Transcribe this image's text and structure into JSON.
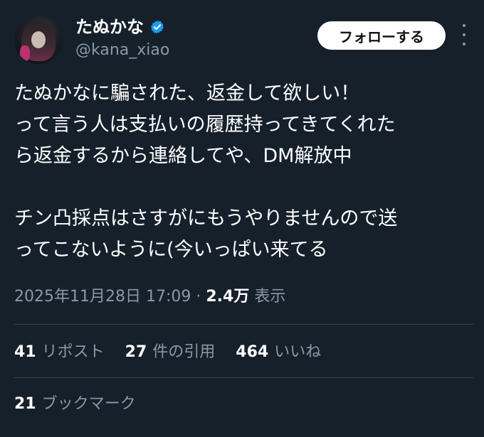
{
  "author": {
    "display_name": "たぬかな",
    "handle": "@kana_xiao",
    "verified_badge_color": "#1d9bf0",
    "avatar_icon": "profile-avatar"
  },
  "actions": {
    "follow_label": "フォローする",
    "more_icon": "more-vertical-icon"
  },
  "tweet": {
    "lines": [
      "たぬかなに騙された、返金して欲しい！",
      "って言う人は支払いの履歴持ってきてくれた",
      "ら返金するから連絡してや、DM解放中",
      "",
      "チン凸採点はさすがにもうやりませんので送",
      "ってこないように(今いっぱい来てる"
    ]
  },
  "meta": {
    "timestamp": "2025年11月28日 17:09",
    "separator": "·",
    "views_count": "2.4万",
    "views_label": "表示"
  },
  "stats": {
    "reposts_count": "41",
    "reposts_label": "リポスト",
    "quotes_count": "27",
    "quotes_label": "件の引用",
    "likes_count": "464",
    "likes_label": "いいね",
    "bookmarks_count": "21",
    "bookmarks_label": "ブックマーク"
  },
  "colors": {
    "background": "#15202b",
    "text_primary": "#ffffff",
    "text_secondary": "#8b98a5",
    "divider": "#38444d",
    "button_bg": "#ffffff"
  }
}
